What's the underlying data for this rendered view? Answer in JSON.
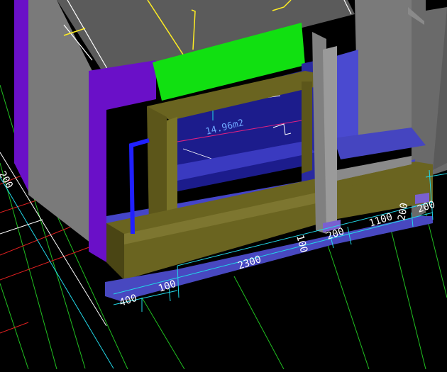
{
  "colors": {
    "background": "#000000",
    "wall_purple": "#6a10c8",
    "wall_grey": "#7a7a7a",
    "roof_grey": "#5b5b5b",
    "beam_green": "#11e011",
    "frame_olive": "#6a6420",
    "floor_blue": "#3a3acc",
    "slab_blue": "#5050c8",
    "dim_cyan": "#22d8e8",
    "grid_green": "#20c020",
    "grid_red": "#e02020",
    "yellow_line": "#ffee22"
  },
  "room": {
    "area_label": "14.96m2"
  },
  "dimensions": {
    "left_partial": "200",
    "d400": "400",
    "d100": "100",
    "d2300": "2300",
    "d100_vertical": "100",
    "d200_a": "200",
    "d1100": "1100",
    "d200_b": "200",
    "d200_c": "200"
  }
}
